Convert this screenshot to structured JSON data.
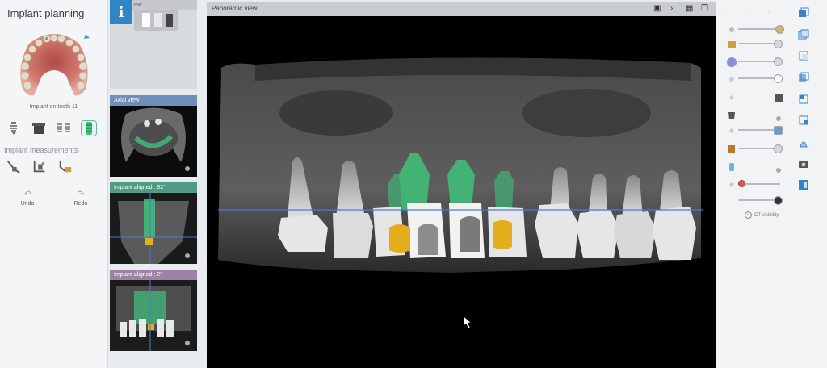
{
  "left_panel": {
    "title": "Implant planning",
    "jaw_caption": "Implant on tooth 11",
    "implant_tools": [
      "implant-icon",
      "abutment-icon",
      "multi-implant-icon",
      "selected-implant-icon"
    ],
    "section_title": "Implant measurements",
    "measurement_tools": [
      "angle-measure-icon",
      "distance-measure-icon",
      "bone-measure-icon"
    ],
    "undo_label": "Undo",
    "redo_label": "Redo"
  },
  "thumbnails": [
    {
      "label": "me"
    },
    {
      "label": "Axial view"
    },
    {
      "label": "Implant aligned : 92°"
    },
    {
      "label": "Implant aligned : 2°"
    }
  ],
  "panoramic": {
    "title": "Panoramic view"
  },
  "right_panel": {
    "ct_visibility_label": "CT visibility"
  },
  "colors": {
    "info_button": "#2f86c6",
    "implant_green": "#3ec27a",
    "abutment_gold": "#e3ad1c",
    "plane_line": "#4a7bd6"
  }
}
